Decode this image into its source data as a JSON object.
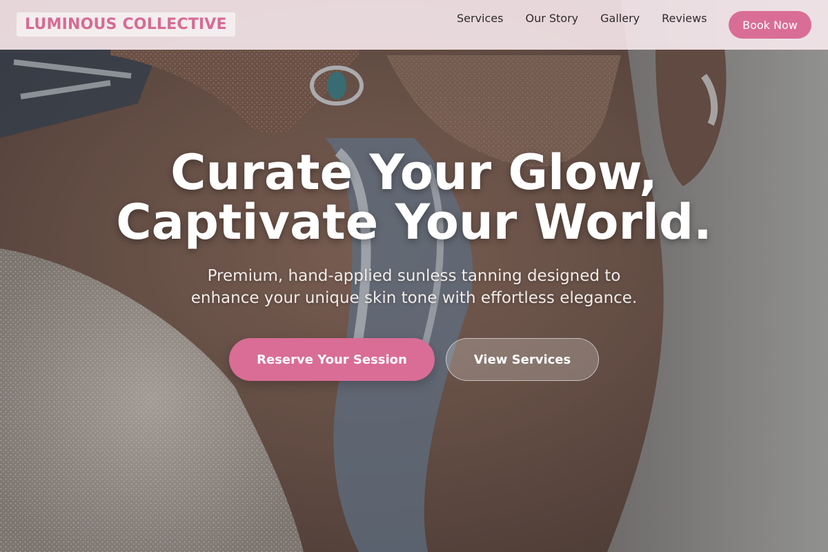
{
  "brand": {
    "name": "LUMINOUS COLLECTIVE",
    "accent_color": "#d96d96"
  },
  "nav": {
    "links": [
      "Services",
      "Our Story",
      "Gallery",
      "Reviews"
    ],
    "cta_label": "Book Now"
  },
  "hero": {
    "headline_line1": "Curate Your Glow,",
    "headline_line2": "Captivate Your World.",
    "subheadline": "Premium, hand-applied sunless tanning designed to enhance your unique skin tone with effortless elegance.",
    "primary_cta": "Reserve Your Session",
    "secondary_cta": "View Services",
    "background_image": "close-up photo of sand-dusted skin, a silver turquoise ring and a blue-white patterned bikini"
  }
}
